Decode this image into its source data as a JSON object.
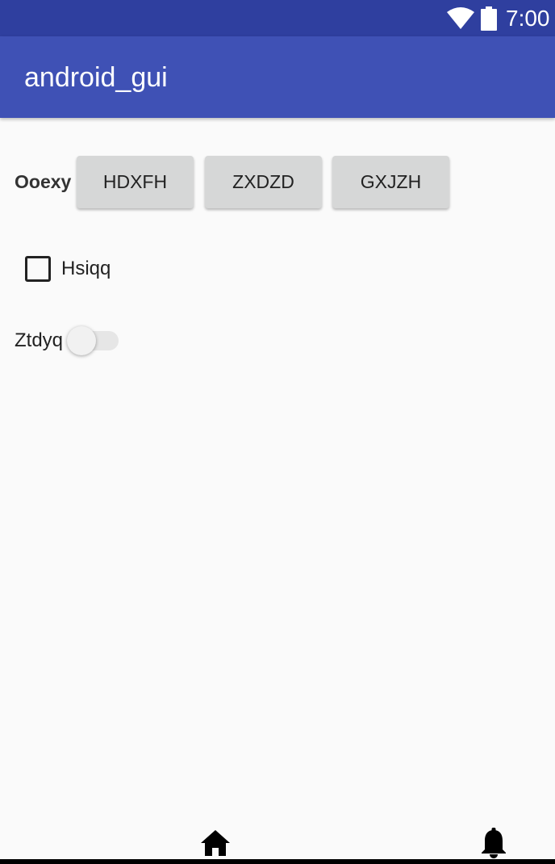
{
  "status_bar": {
    "time": "7:00",
    "icons": [
      "wifi-icon",
      "battery-icon"
    ],
    "color": "#2f3f9f"
  },
  "app_bar": {
    "title": "android_gui",
    "color": "#3f51b5"
  },
  "content": {
    "row_label": "Ooexy",
    "buttons": [
      "HDXFH",
      "ZXDZD",
      "GXJZH"
    ],
    "checkbox": {
      "label": "Hsiqq",
      "checked": false
    },
    "switch": {
      "label": "Ztdyq",
      "on": false
    }
  },
  "bottom_nav": {
    "icons": [
      "home-icon",
      "bell-icon"
    ]
  }
}
